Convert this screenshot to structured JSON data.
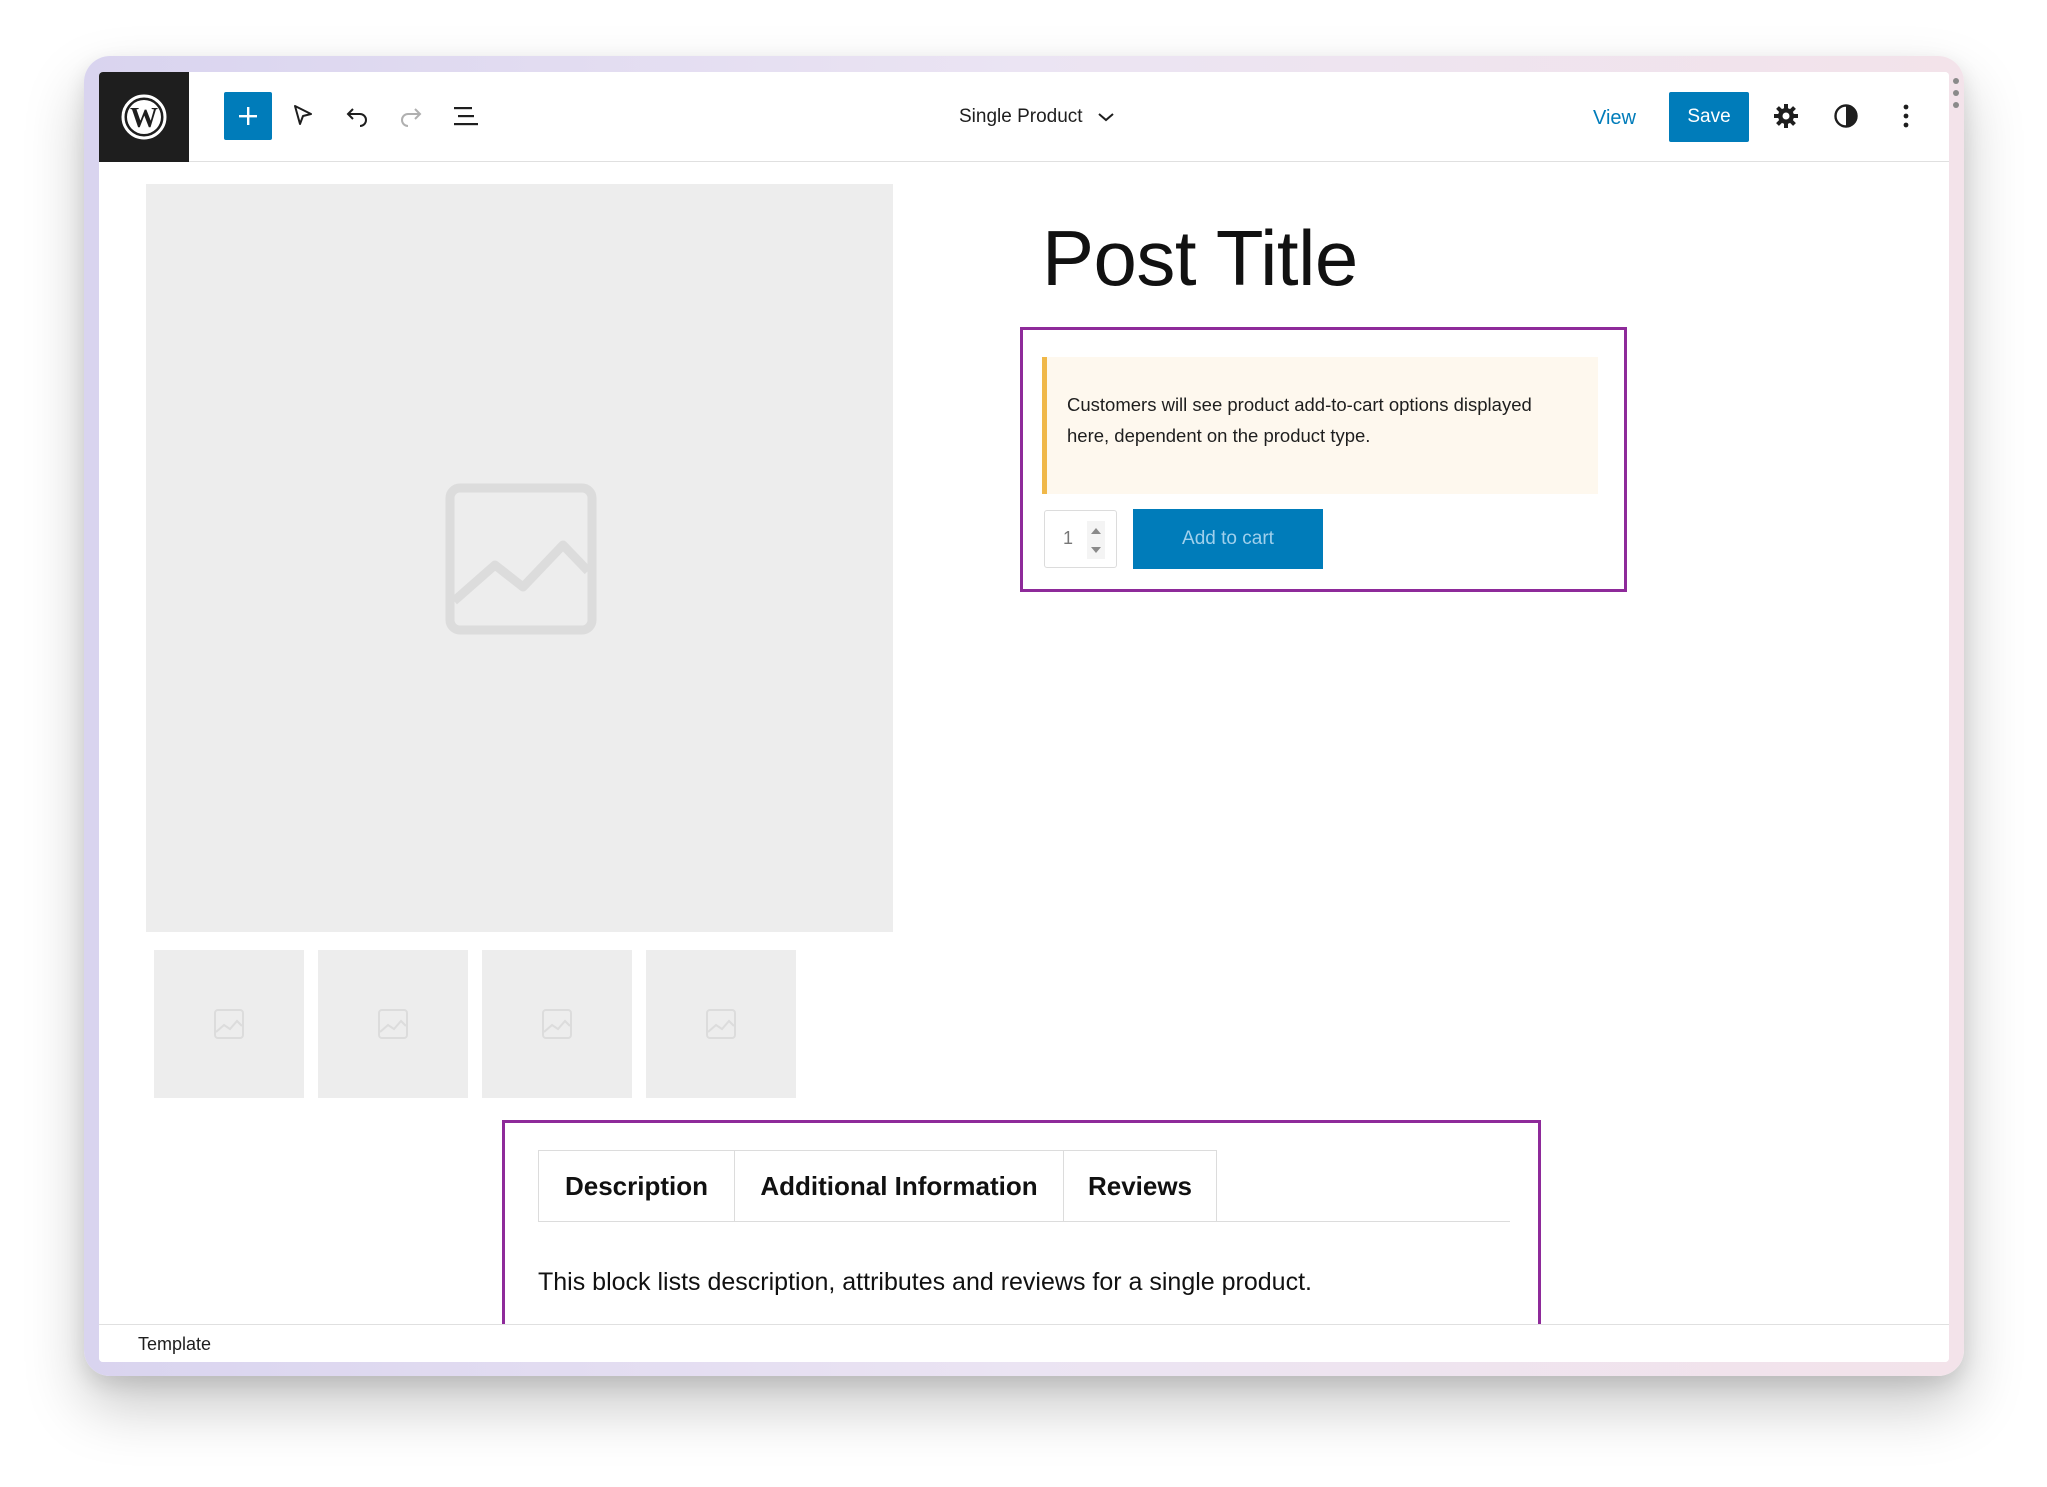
{
  "header": {
    "logo_icon": "wordpress-logo-icon",
    "toolbar_icons": [
      "plus-icon",
      "select-tool-icon",
      "undo-icon",
      "redo-icon",
      "list-view-icon"
    ],
    "document_title": "Single Product",
    "view_label": "View",
    "save_label": "Save",
    "right_icons": [
      "gear-icon",
      "contrast-icon",
      "more-vertical-icon"
    ]
  },
  "product": {
    "title": "Post Title",
    "notice": "Customers will see product add-to-cart options displayed here, dependent on the product type.",
    "quantity": "1",
    "add_to_cart_label": "Add to cart"
  },
  "tabs": {
    "items": [
      {
        "label": "Description"
      },
      {
        "label": "Additional Information"
      },
      {
        "label": "Reviews"
      }
    ],
    "description": "This block lists description, attributes and reviews for a single product."
  },
  "footer": {
    "breadcrumb": "Template"
  },
  "colors": {
    "accent": "#007cba",
    "highlight": "#8e2a9a",
    "notice_border": "#f0b849",
    "notice_bg": "#fef8ee",
    "placeholder_bg": "#ededed"
  }
}
